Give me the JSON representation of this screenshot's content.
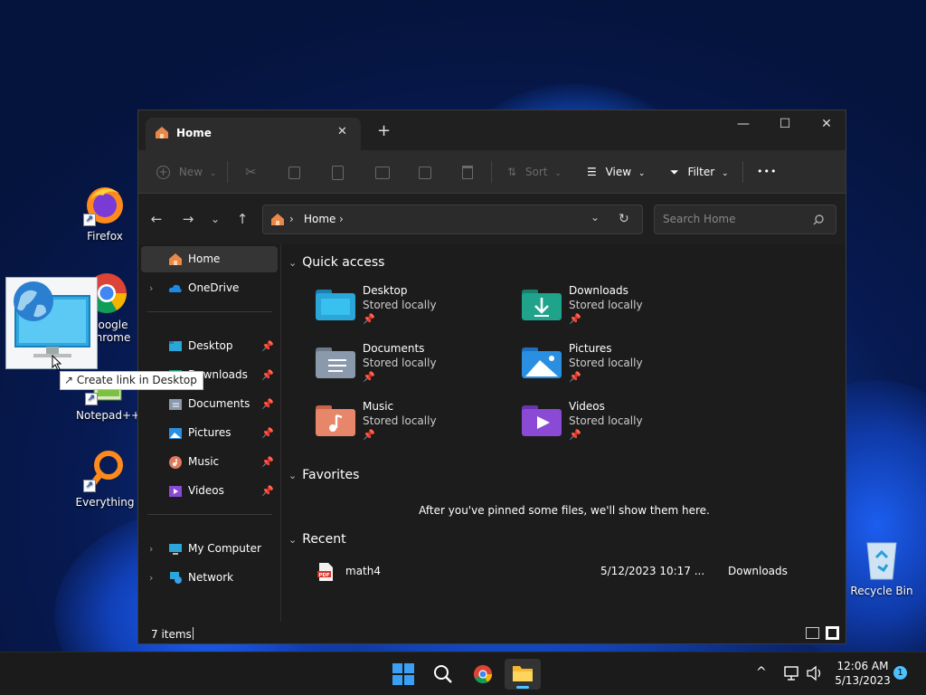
{
  "desktop": {
    "icons": [
      {
        "label": "Firefox"
      },
      {
        "label": "oogle\nhrome"
      },
      {
        "label": "Notepad++"
      },
      {
        "label": "Everything"
      },
      {
        "label": "Recycle Bin"
      }
    ],
    "tooltip": "Create link in Desktop",
    "shortcut_glyph": "↗"
  },
  "window": {
    "tab_title": "Home",
    "tab_close": "✕",
    "new_tab": "+",
    "controls": {
      "minimize": "—",
      "maximize": "☐",
      "close": "✕"
    },
    "toolbar": {
      "new_label": "New",
      "sort_label": "Sort",
      "view_label": "View",
      "filter_label": "Filter",
      "more_label": "•••"
    },
    "address": {
      "crumb": "Home",
      "separator": "›",
      "search_placeholder": "Search Home"
    },
    "sidebar": {
      "items": [
        {
          "label": "Home"
        },
        {
          "label": "OneDrive"
        },
        {
          "label": "Desktop"
        },
        {
          "label": "Downloads"
        },
        {
          "label": "Documents"
        },
        {
          "label": "Pictures"
        },
        {
          "label": "Music"
        },
        {
          "label": "Videos"
        },
        {
          "label": "My Computer"
        },
        {
          "label": "Network"
        }
      ]
    },
    "sections": {
      "quick_access": "Quick access",
      "favorites": "Favorites",
      "favorites_empty": "After you've pinned some files, we'll show them here.",
      "recent": "Recent"
    },
    "quick_access": [
      {
        "name": "Desktop",
        "status": "Stored locally"
      },
      {
        "name": "Downloads",
        "status": "Stored locally"
      },
      {
        "name": "Documents",
        "status": "Stored locally"
      },
      {
        "name": "Pictures",
        "status": "Stored locally"
      },
      {
        "name": "Music",
        "status": "Stored locally"
      },
      {
        "name": "Videos",
        "status": "Stored locally"
      }
    ],
    "recent": [
      {
        "name": "math4",
        "date": "5/12/2023 10:17 ...",
        "location": "Downloads"
      }
    ],
    "status": {
      "item_count": "7 items"
    }
  },
  "taskbar": {
    "time": "12:06 AM",
    "date": "5/13/2023",
    "notifications": "1",
    "overflow": "^"
  },
  "colors": {
    "accent": "#1e88e5",
    "window_bg": "#1c1c1c",
    "toolbar_bg": "#2c2c2c",
    "home_icon": "#e8884a"
  }
}
